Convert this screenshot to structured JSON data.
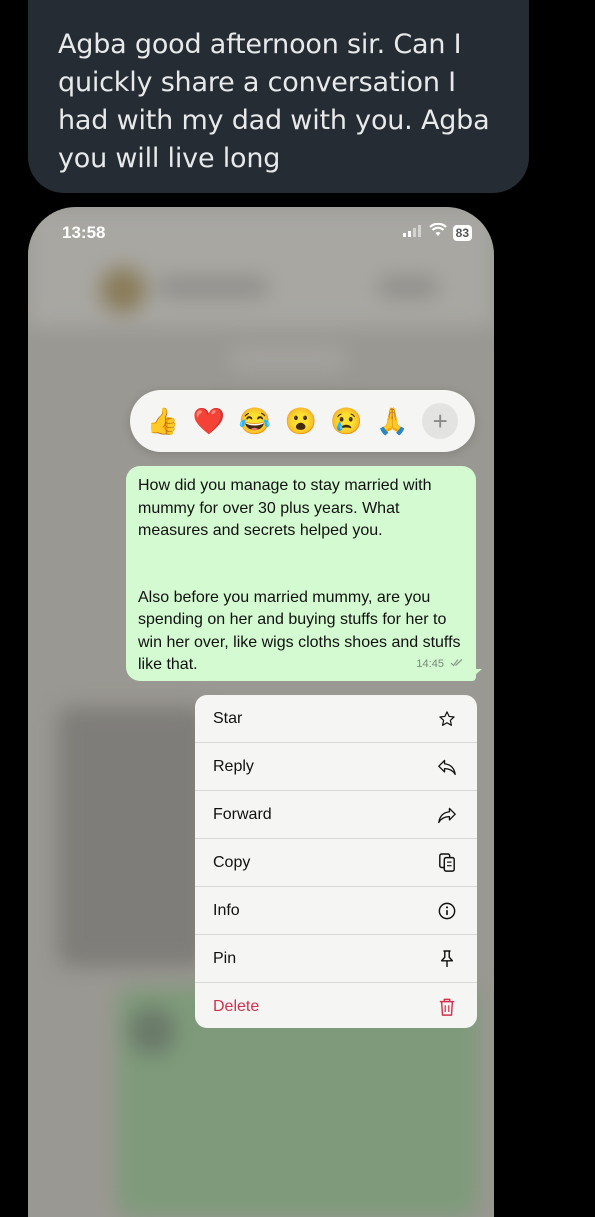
{
  "tweet": {
    "text": "Agba good afternoon sir. Can I quickly share a conversation I had with my dad with you. Agba you will live long"
  },
  "status_bar": {
    "time": "13:58",
    "battery": "83"
  },
  "reactions": [
    {
      "emoji": "👍",
      "name": "thumbs-up"
    },
    {
      "emoji": "❤️",
      "name": "red-heart"
    },
    {
      "emoji": "😂",
      "name": "tears-of-joy"
    },
    {
      "emoji": "😮",
      "name": "surprised"
    },
    {
      "emoji": "😢",
      "name": "crying"
    },
    {
      "emoji": "🙏",
      "name": "folded-hands"
    }
  ],
  "reaction_more": "+",
  "message": {
    "paragraph1": "How did you manage to stay married with mummy for over 30 plus years. What measures and secrets helped you.",
    "paragraph2": "Also before you married mummy, are you spending on her and buying stuffs for her to win her over, like wigs cloths shoes and stuffs like that.",
    "time": "14:45"
  },
  "menu": [
    {
      "label": "Star",
      "icon": "star-icon"
    },
    {
      "label": "Reply",
      "icon": "reply-icon"
    },
    {
      "label": "Forward",
      "icon": "forward-icon"
    },
    {
      "label": "Copy",
      "icon": "copy-icon"
    },
    {
      "label": "Info",
      "icon": "info-icon"
    },
    {
      "label": "Pin",
      "icon": "pin-icon"
    },
    {
      "label": "Delete",
      "icon": "trash-icon"
    }
  ],
  "colors": {
    "tweet_bg": "#252c33",
    "message_bg": "#d3fad0",
    "delete": "#d2314f"
  }
}
